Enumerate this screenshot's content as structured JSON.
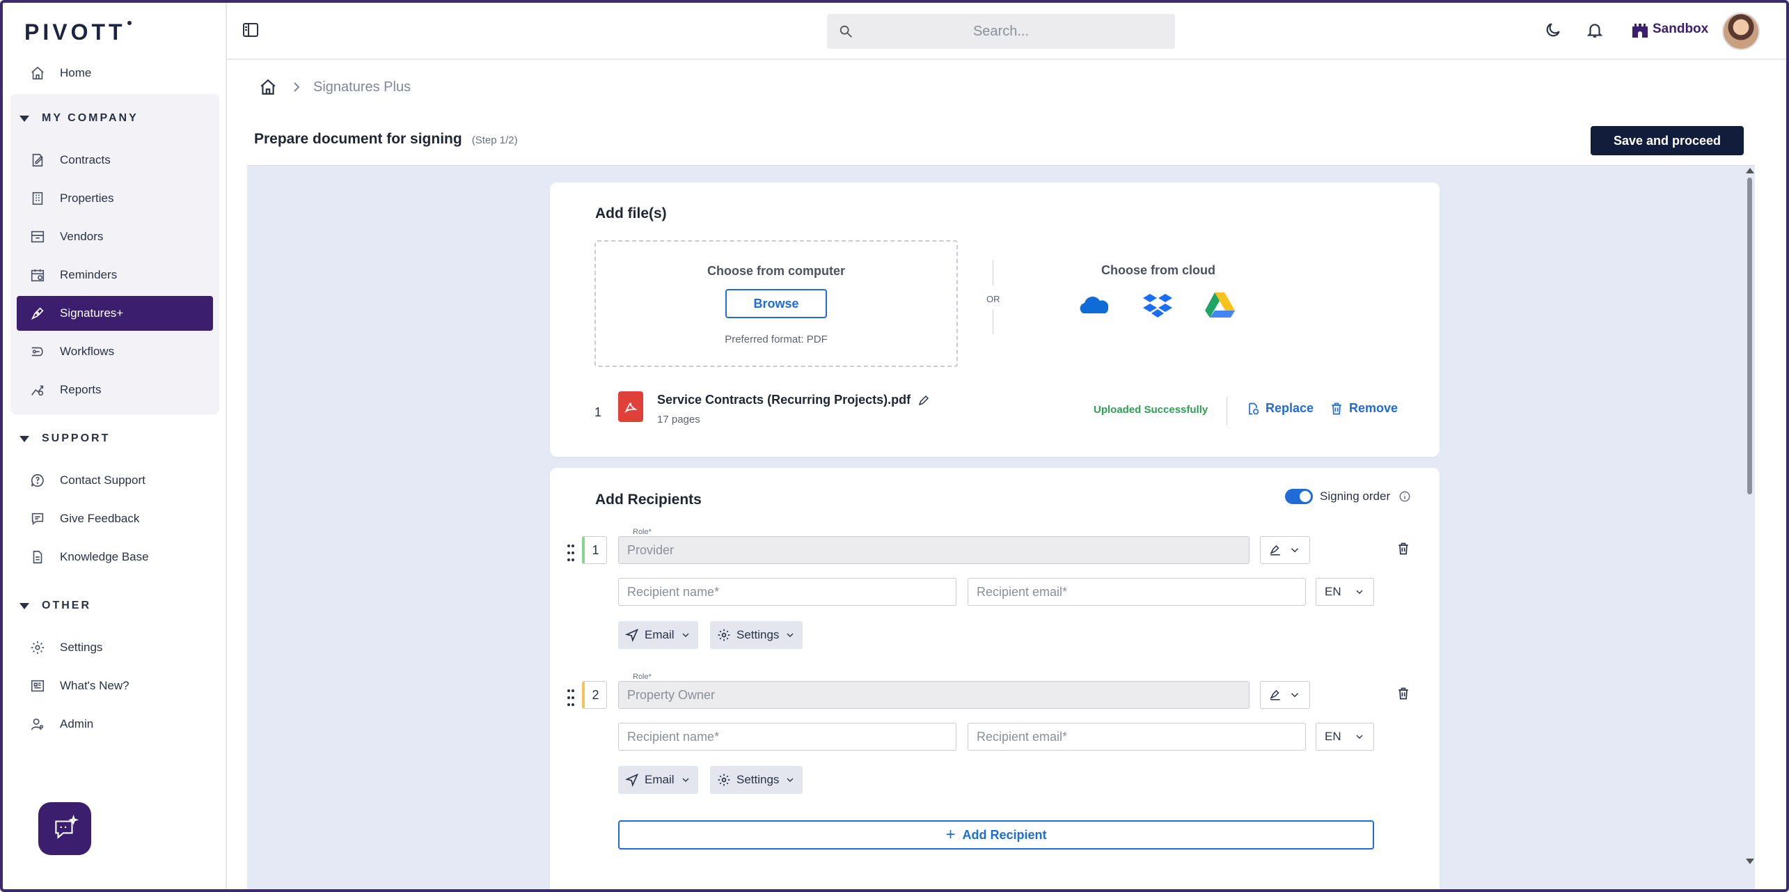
{
  "app": {
    "logo": "PIVOTT"
  },
  "sidebar": {
    "home": "Home",
    "sections": [
      {
        "title": "MY COMPANY"
      },
      {
        "title": "SUPPORT"
      },
      {
        "title": "OTHER"
      }
    ],
    "company_items": [
      {
        "label": "Contracts",
        "icon": "contract-icon"
      },
      {
        "label": "Properties",
        "icon": "building-icon"
      },
      {
        "label": "Vendors",
        "icon": "vendor-icon"
      },
      {
        "label": "Reminders",
        "icon": "calendar-icon"
      },
      {
        "label": "Signatures+",
        "icon": "pen-icon",
        "active": true
      },
      {
        "label": "Workflows",
        "icon": "workflow-icon"
      },
      {
        "label": "Reports",
        "icon": "reports-icon"
      }
    ],
    "support_items": [
      {
        "label": "Contact Support",
        "icon": "help-icon"
      },
      {
        "label": "Give Feedback",
        "icon": "feedback-icon"
      },
      {
        "label": "Knowledge Base",
        "icon": "document-icon"
      }
    ],
    "other_items": [
      {
        "label": "Settings",
        "icon": "gear-icon"
      },
      {
        "label": "What's New?",
        "icon": "news-icon"
      },
      {
        "label": "Admin",
        "icon": "admin-icon"
      }
    ]
  },
  "topbar": {
    "search_placeholder": "Search...",
    "environment": "Sandbox"
  },
  "breadcrumb": {
    "current": "Signatures Plus"
  },
  "page": {
    "title": "Prepare document for signing",
    "step": "(Step 1/2)",
    "primary_action": "Save and proceed"
  },
  "files": {
    "title": "Add file(s)",
    "computer_title": "Choose from computer",
    "browse_label": "Browse",
    "preferred_format": "Preferred format: PDF",
    "or_label": "OR",
    "cloud_title": "Choose from cloud",
    "cloud_providers": [
      "OneDrive",
      "Dropbox",
      "Google Drive"
    ],
    "items": [
      {
        "index": "1",
        "name": "Service Contracts (Recurring Projects).pdf",
        "pages": "17 pages",
        "status": "Uploaded Successfully",
        "replace_label": "Replace",
        "remove_label": "Remove"
      }
    ]
  },
  "recipients": {
    "title": "Add Recipients",
    "signing_order_label": "Signing order",
    "signing_order_enabled": true,
    "role_label": "Role*",
    "name_placeholder": "Recipient name*",
    "email_placeholder": "Recipient email*",
    "delivery_label": "Email",
    "settings_label": "Settings",
    "items": [
      {
        "index": "1",
        "role": "Provider",
        "language": "EN",
        "accent": "#8bd48f"
      },
      {
        "index": "2",
        "role": "Property Owner",
        "language": "EN",
        "accent": "#f2c55c"
      }
    ],
    "add_label": "Add Recipient"
  },
  "colors": {
    "brand": "#3b1f6e",
    "primary_button": "#121d3b",
    "link": "#1f6bd8",
    "success": "#2f9e52",
    "content_bg": "#e4e9f5"
  }
}
